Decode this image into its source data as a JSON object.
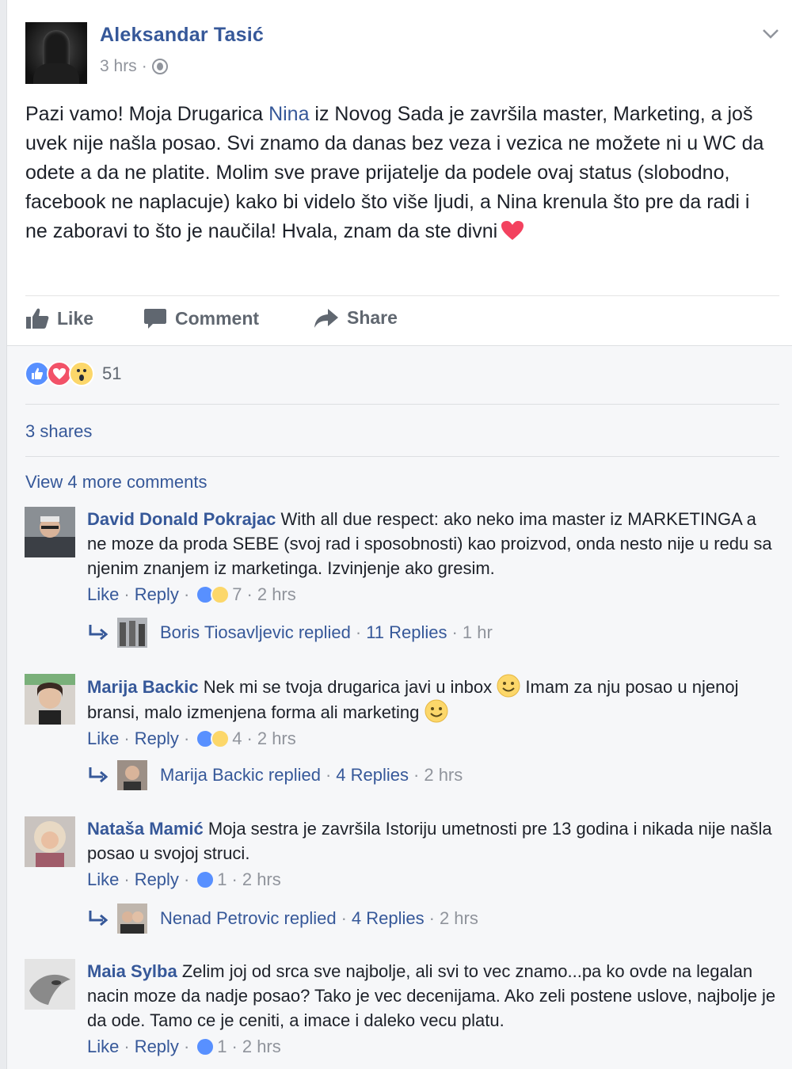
{
  "post": {
    "author": "Aleksandar Tasić",
    "time": "3 hrs",
    "separator": "·",
    "text": {
      "part1": "Pazi vamo! Moja Drugarica ",
      "mention": "Nina",
      "part2": " iz Novog Sada je završila master, Marketing, a još uvek nije našla posao. Svi znamo da danas bez veza i vezica ne možete ni u WC da odete a da ne platite. Molim sve prave prijatelje da podele ovaj status (slobodno, facebook ne naplacuje) kako bi videlo što više ljudi, a Nina krenula što pre da radi i ne zaboravi to što je naučila! Hvala, znam da ste divni"
    },
    "actions": {
      "like": "Like",
      "comment": "Comment",
      "share": "Share"
    },
    "reaction_count": "51",
    "shares": "3 shares",
    "view_more": "View 4 more comments"
  },
  "comments": [
    {
      "name": "David Donald Pokrajac",
      "text": "With all due respect: ako neko ima master iz MARKETINGA a ne moze da proda SEBE (svoj rad i sposobnosti) kao proizvod, onda nesto nije u redu sa njenim znanjem iz marketinga. Izvinjenje ako gresim.",
      "like": "Like",
      "reply": "Reply",
      "reactions": "7",
      "time": "2 hrs",
      "replied_by": "Boris Tiosavljevic replied",
      "replies": "11 Replies",
      "reply_time": "1 hr"
    },
    {
      "name": "Marija Backic",
      "text_a": "Nek mi se tvoja drugarica javi u inbox",
      "text_b": "Imam za nju posao u njenoj bransi, malo izmenjena forma ali marketing",
      "like": "Like",
      "reply": "Reply",
      "reactions": "4",
      "time": "2 hrs",
      "replied_by": "Marija Backic replied",
      "replies": "4 Replies",
      "reply_time": "2 hrs"
    },
    {
      "name": "Nataša Mamić",
      "text": "Moja sestra je završila Istoriju umetnosti pre 13 godina i nikada nije našla posao u svojoj struci.",
      "like": "Like",
      "reply": "Reply",
      "reactions": "1",
      "time": "2 hrs",
      "replied_by": "Nenad Petrovic replied",
      "replies": "4 Replies",
      "reply_time": "2 hrs"
    },
    {
      "name": "Maia Sylba",
      "text": "Zelim joj od srca sve najbolje, ali svi to vec znamo...pa ko ovde na legalan nacin moze da nadje posao? Tako je vec decenijama. Ako zeli postene uslove, najbolje je da ode. Tamo ce je ceniti, a imace i daleko vecu platu.",
      "like": "Like",
      "reply": "Reply",
      "reactions": "1",
      "time": "2 hrs"
    }
  ],
  "colors": {
    "link": "#365899",
    "muted": "#90949c",
    "like_blue": "#5890ff",
    "love_red": "#f25268",
    "wow_yellow": "#fcd76a"
  }
}
